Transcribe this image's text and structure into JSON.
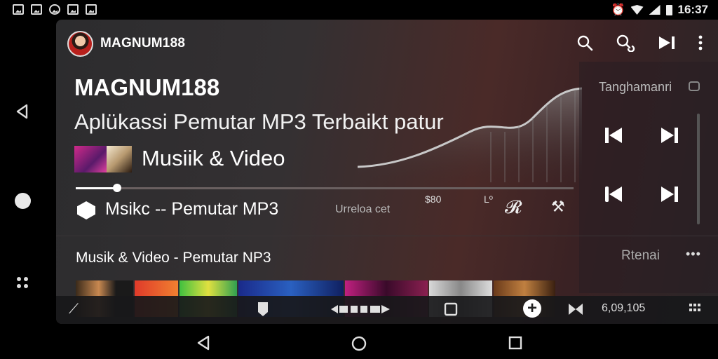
{
  "status_bar": {
    "time": "16:37",
    "icons": [
      "gallery-icon",
      "image-icon",
      "sync-icon",
      "photo-icon",
      "warning-icon",
      "alarm-icon",
      "wifi-icon",
      "signal-icon",
      "battery-icon"
    ]
  },
  "app": {
    "name": "MAGNUM188",
    "title": "MAGNUM188",
    "subtitle": "Aplükassi Pemutar MP3 Terbaikt patur",
    "category_label": "Musiik & Video",
    "header_icons": [
      "search-icon",
      "search-settings-icon",
      "skip-next-icon",
      "more-icon"
    ]
  },
  "now_playing": {
    "title": "Msikc -- Pemutar MP3",
    "status": "Urreloa cet",
    "meta_value": "$80",
    "meta_label": "Lº",
    "progress_fraction": 0.08
  },
  "right_panel": {
    "title": "Tanghamanri",
    "controls": [
      "skip-previous-icon",
      "skip-next-icon",
      "skip-previous-icon",
      "skip-next-icon"
    ]
  },
  "section": {
    "title": "Musik & Video - Pemutar NP3",
    "more_label": "Rtenai",
    "kebab": "•••"
  },
  "toolbar": {
    "time": "6,09,105",
    "icons": [
      "edit-icon",
      "tag-icon",
      "playlist-icon",
      "square-icon",
      "add-icon",
      "shuffle-icon",
      "grid-icon"
    ]
  },
  "colors": {
    "app_bg": "#2c2c2e",
    "accent_red": "#4a2a28",
    "text": "#ffffff"
  }
}
